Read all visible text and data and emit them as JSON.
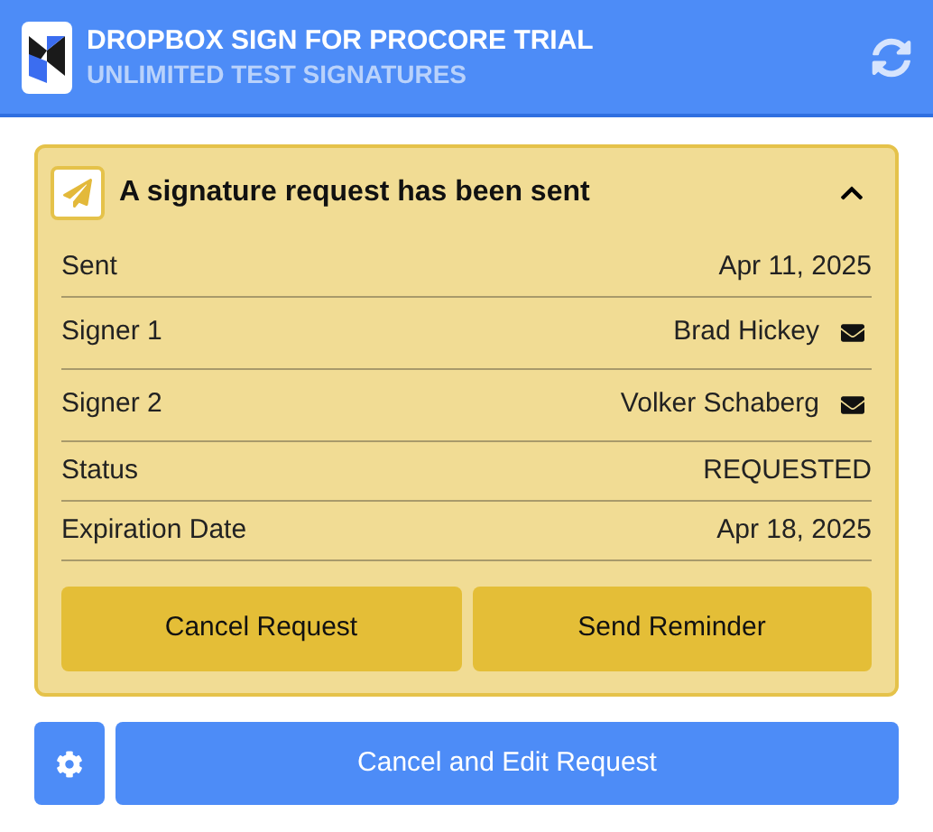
{
  "header": {
    "title": "DROPBOX SIGN FOR PROCORE TRIAL",
    "subtitle": "UNLIMITED TEST SIGNATURES"
  },
  "card": {
    "title": "A signature request has been sent",
    "expanded": true,
    "rows": [
      {
        "kind": "plain",
        "label": "Sent",
        "value": "Apr 11, 2025"
      },
      {
        "kind": "signer",
        "label": "Signer 1",
        "value": "Brad Hickey"
      },
      {
        "kind": "signer",
        "label": "Signer 2",
        "value": "Volker Schaberg"
      },
      {
        "kind": "plain",
        "label": "Status",
        "value": "REQUESTED"
      },
      {
        "kind": "plain",
        "label": "Expiration Date",
        "value": "Apr 18, 2025"
      }
    ],
    "buttons": [
      "Cancel Request",
      "Send Reminder"
    ]
  },
  "footer": {
    "button": "Cancel and Edit Request"
  }
}
